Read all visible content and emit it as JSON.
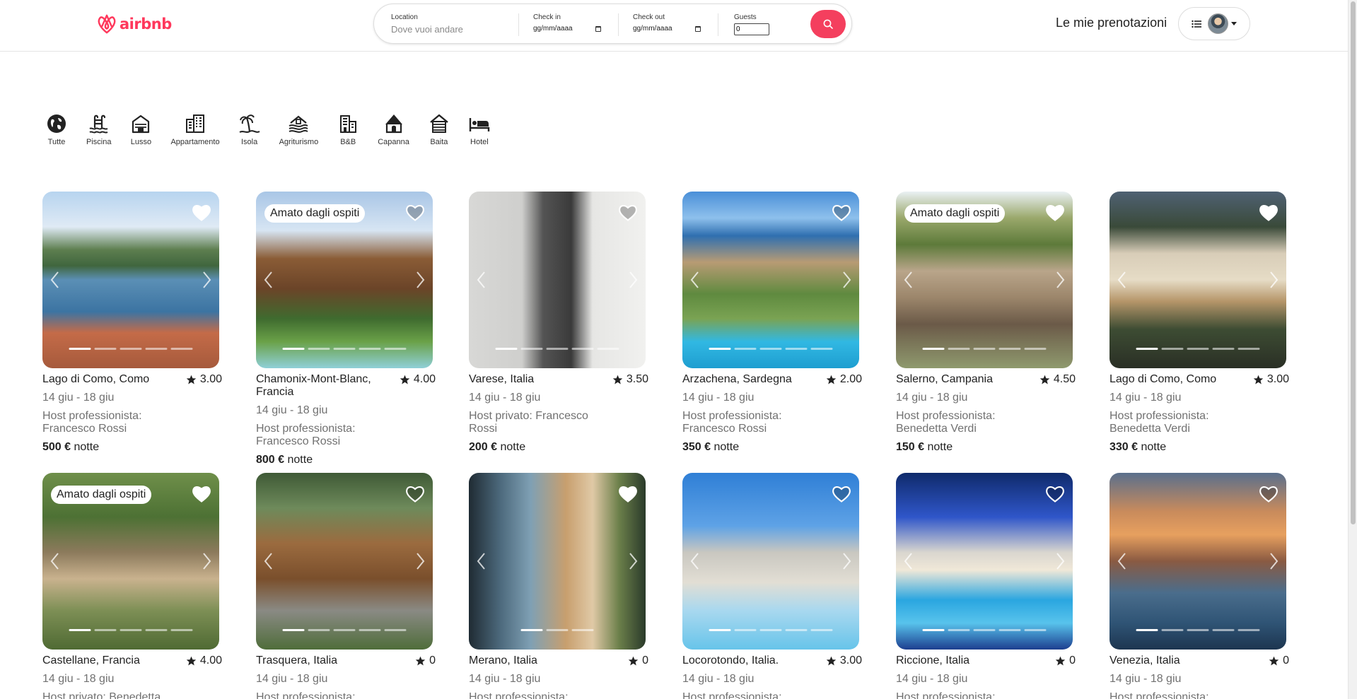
{
  "header": {
    "logo_text": "airbnb",
    "reservations_label": "Le mie prenotazioni"
  },
  "search": {
    "location_label": "Location",
    "location_placeholder": "Dove vuoi andare",
    "checkin_label": "Check in",
    "checkin_value": "gg/mm/aaaa",
    "checkout_label": "Check out",
    "checkout_value": "gg/mm/aaaa",
    "guests_label": "Guests",
    "guests_value": "0"
  },
  "categories": [
    {
      "label": "Tutte",
      "icon": "globe-icon"
    },
    {
      "label": "Piscina",
      "icon": "pool-icon"
    },
    {
      "label": "Lusso",
      "icon": "luxury-icon"
    },
    {
      "label": "Appartamento",
      "icon": "apartment-icon"
    },
    {
      "label": "Isola",
      "icon": "island-icon"
    },
    {
      "label": "Agriturismo",
      "icon": "farm-icon"
    },
    {
      "label": "B&B",
      "icon": "bnb-icon"
    },
    {
      "label": "Capanna",
      "icon": "hut-icon"
    },
    {
      "label": "Baita",
      "icon": "cabin-icon"
    },
    {
      "label": "Hotel",
      "icon": "bed-icon"
    }
  ],
  "listings": [
    {
      "title": "Lago di Como, Como",
      "rating": "3.00",
      "dates": "14 giu - 18 giu",
      "host": "Host professionista: Francesco Rossi",
      "price": "500 €",
      "price_unit": "notte",
      "badge": "",
      "favorite": true
    },
    {
      "title": "Chamonix-Mont-Blanc, Francia",
      "rating": "4.00",
      "dates": "14 giu - 18 giu",
      "host": "Host professionista: Francesco Rossi",
      "price": "800 €",
      "price_unit": "notte",
      "badge": "Amato dagli ospiti",
      "favorite": false
    },
    {
      "title": "Varese, Italia",
      "rating": "3.50",
      "dates": "14 giu - 18 giu",
      "host": "Host privato: Francesco Rossi",
      "price": "200 €",
      "price_unit": "notte",
      "badge": "",
      "favorite": false
    },
    {
      "title": "Arzachena, Sardegna",
      "rating": "2.00",
      "dates": "14 giu - 18 giu",
      "host": "Host professionista: Francesco Rossi",
      "price": "350 €",
      "price_unit": "notte",
      "badge": "",
      "favorite": false
    },
    {
      "title": "Salerno, Campania",
      "rating": "4.50",
      "dates": "14 giu - 18 giu",
      "host": "Host professionista: Benedetta Verdi",
      "price": "150 €",
      "price_unit": "notte",
      "badge": "Amato dagli ospiti",
      "favorite": true
    },
    {
      "title": "Lago di Como, Como",
      "rating": "3.00",
      "dates": "14 giu - 18 giu",
      "host": "Host professionista: Benedetta Verdi",
      "price": "330 €",
      "price_unit": "notte",
      "badge": "",
      "favorite": true
    },
    {
      "title": "Castellane, Francia",
      "rating": "4.00",
      "dates": "14 giu - 18 giu",
      "host": "Host privato: Benedetta",
      "price": "",
      "price_unit": "",
      "badge": "Amato dagli ospiti",
      "favorite": true
    },
    {
      "title": "Trasquera, Italia",
      "rating": "0",
      "dates": "14 giu - 18 giu",
      "host": "Host professionista:",
      "price": "",
      "price_unit": "",
      "badge": "",
      "favorite": false
    },
    {
      "title": "Merano, Italia",
      "rating": "0",
      "dates": "14 giu - 18 giu",
      "host": "Host professionista:",
      "price": "",
      "price_unit": "",
      "badge": "",
      "favorite": true
    },
    {
      "title": "Locorotondo, Italia.",
      "rating": "3.00",
      "dates": "14 giu - 18 giu",
      "host": "Host professionista:",
      "price": "",
      "price_unit": "",
      "badge": "",
      "favorite": false
    },
    {
      "title": "Riccione, Italia",
      "rating": "0",
      "dates": "14 giu - 18 giu",
      "host": "Host professionista:",
      "price": "",
      "price_unit": "",
      "badge": "",
      "favorite": false
    },
    {
      "title": "Venezia, Italia",
      "rating": "0",
      "dates": "14 giu - 18 giu",
      "host": "Host professionista:",
      "price": "",
      "price_unit": "",
      "badge": "",
      "favorite": false
    }
  ],
  "colors": {
    "brand": "#ff385c",
    "search_button": "#f43f5e",
    "muted_text": "#717171"
  }
}
